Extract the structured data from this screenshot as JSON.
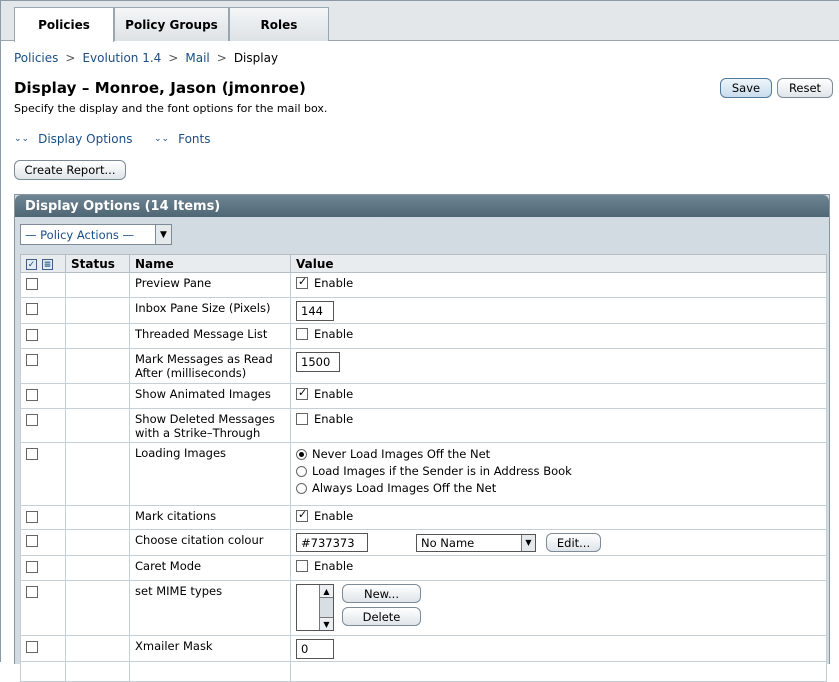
{
  "tabs": [
    {
      "label": "Policies",
      "active": true
    },
    {
      "label": "Policy Groups",
      "active": false
    },
    {
      "label": "Roles",
      "active": false
    }
  ],
  "breadcrumb": {
    "items": [
      "Policies",
      "Evolution 1.4",
      "Mail"
    ],
    "current": "Display",
    "separator": ">"
  },
  "header": {
    "title": "Display – Monroe, Jason (jmonroe)",
    "subtitle": "Specify the display and the font options for the mail box.",
    "save_label": "Save",
    "reset_label": "Reset"
  },
  "jump_links": [
    "Display Options",
    "Fonts"
  ],
  "create_report_label": "Create Report...",
  "table": {
    "heading": "Display Options (14 Items)",
    "policy_actions_label": "— Policy Actions —",
    "columns": {
      "status": "Status",
      "name": "Name",
      "value": "Value"
    },
    "enable_label": "Enable",
    "rows": [
      {
        "name": "Preview Pane",
        "type": "checkbox",
        "checked": true
      },
      {
        "name": "Inbox Pane Size (Pixels)",
        "type": "text",
        "value": "144"
      },
      {
        "name": "Threaded Message List",
        "type": "checkbox",
        "checked": false
      },
      {
        "name": "Mark Messages as Read After (milliseconds)",
        "type": "text",
        "value": "1500"
      },
      {
        "name": "Show Animated Images",
        "type": "checkbox",
        "checked": true
      },
      {
        "name": "Show Deleted Messages with a Strike–Through",
        "type": "checkbox",
        "checked": false
      },
      {
        "name": "Loading Images",
        "type": "radio",
        "options": [
          "Never Load Images Off the Net",
          "Load Images if the Sender is in Address Book",
          "Always Load Images Off the Net"
        ],
        "selected": 0
      },
      {
        "name": "Mark citations",
        "type": "checkbox",
        "checked": true
      },
      {
        "name": "Choose citation colour",
        "type": "color",
        "value": "#737373",
        "select_value": "No Name",
        "edit_label": "Edit..."
      },
      {
        "name": "Caret Mode",
        "type": "checkbox",
        "checked": false
      },
      {
        "name": "set MIME types",
        "type": "list",
        "new_label": "New...",
        "delete_label": "Delete"
      },
      {
        "name": "Xmailer Mask",
        "type": "text",
        "value": "0"
      }
    ]
  },
  "colors": {
    "header_bar": "#5a7080",
    "link": "#1a4e86",
    "tab_bg": "#e3e7ea"
  }
}
